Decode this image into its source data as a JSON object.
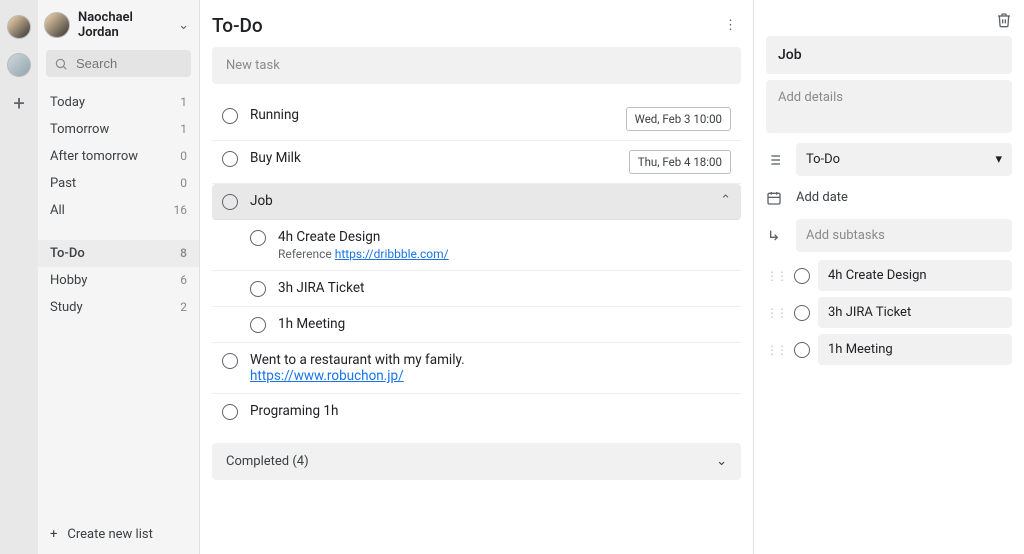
{
  "user": {
    "name": "Naochael Jordan"
  },
  "search": {
    "placeholder": "Search"
  },
  "filters": [
    {
      "label": "Today",
      "count": 1
    },
    {
      "label": "Tomorrow",
      "count": 1
    },
    {
      "label": "After tomorrow",
      "count": 0
    },
    {
      "label": "Past",
      "count": 0
    },
    {
      "label": "All",
      "count": 16
    }
  ],
  "lists": [
    {
      "label": "To-Do",
      "count": 8,
      "selected": true
    },
    {
      "label": "Hobby",
      "count": 6
    },
    {
      "label": "Study",
      "count": 2
    }
  ],
  "create_list": "Create new list",
  "main": {
    "title": "To-Do",
    "new_task_placeholder": "New task",
    "completed_label": "Completed (4)",
    "tasks": [
      {
        "title": "Running",
        "date": "Wed, Feb 3 10:00"
      },
      {
        "title": "Buy Milk",
        "date": "Thu, Feb 4 18:00"
      },
      {
        "title": "Job",
        "selected": true,
        "expanded": true
      },
      {
        "title": "Went to a restaurant with my family.",
        "link": "https://www.robuchon.jp/"
      },
      {
        "title": "Programing 1h"
      }
    ],
    "subtasks": [
      {
        "title": "4h Create Design",
        "sub_prefix": "Reference ",
        "sub_link": "https://dribbble.com/"
      },
      {
        "title": "3h JIRA Ticket"
      },
      {
        "title": "1h Meeting"
      }
    ]
  },
  "detail": {
    "title": "Job",
    "details_placeholder": "Add details",
    "list_selected": "To-Do",
    "add_date": "Add date",
    "add_subtasks_placeholder": "Add subtasks",
    "subtasks": [
      {
        "label": "4h Create Design"
      },
      {
        "label": "3h JIRA Ticket"
      },
      {
        "label": "1h Meeting"
      }
    ]
  }
}
